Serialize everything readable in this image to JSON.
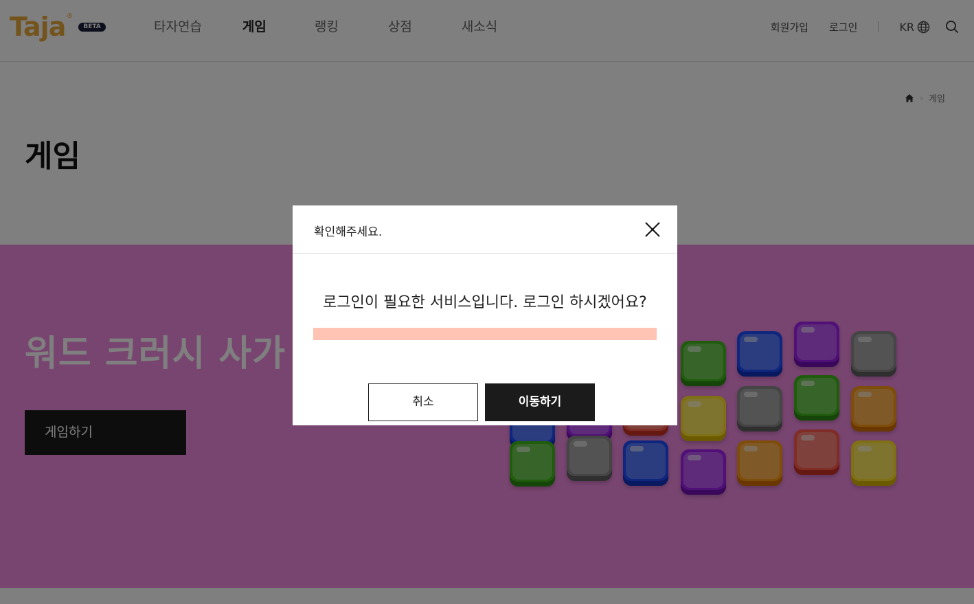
{
  "header": {
    "logo_text": "Taja",
    "logo_reg": "®",
    "beta_label": "BETA",
    "nav": [
      {
        "label": "타자연습"
      },
      {
        "label": "게임"
      },
      {
        "label": "랭킹"
      },
      {
        "label": "상점"
      },
      {
        "label": "새소식"
      }
    ],
    "active_nav": "게임",
    "join_label": "회원가입",
    "login_label": "로그인",
    "lang_label": "KR"
  },
  "breadcrumb": {
    "current": "게임"
  },
  "page_title": "게임",
  "banner": {
    "game_title": "워드 크러시 사가",
    "play_label": "게임하기",
    "background_color": "#f08ae0"
  },
  "modal": {
    "title": "확인해주세요.",
    "message": "로그인이 필요한 서비스입니다. 로그인 하시겠어요?",
    "cancel_label": "취소",
    "confirm_label": "이동하기"
  },
  "colors": {
    "logo": "#e8a93a",
    "nav_highlight": "#6ce5e0",
    "message_highlight": "#ffc4b3",
    "button_dark": "#1b1b1b"
  }
}
